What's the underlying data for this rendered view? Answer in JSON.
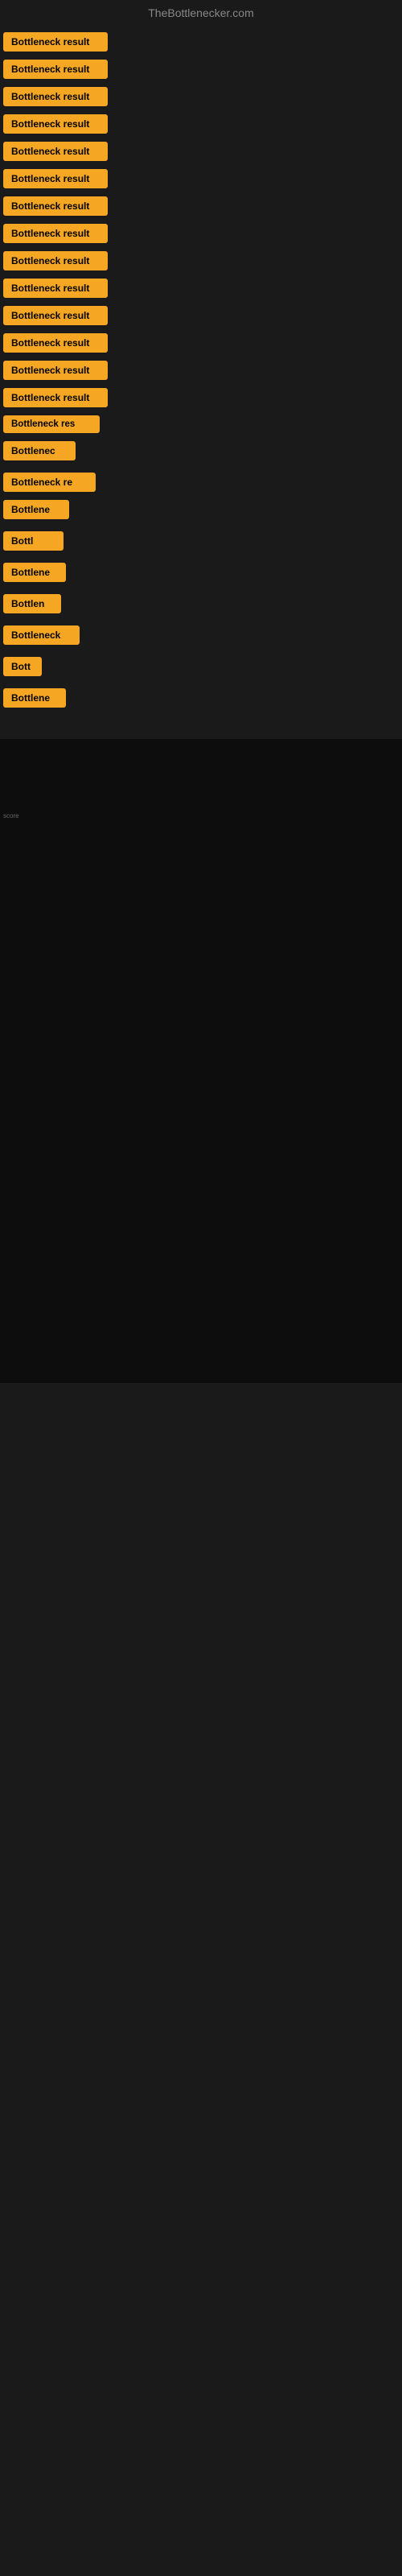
{
  "header": {
    "title": "TheBottlenecker.com"
  },
  "items": [
    {
      "label": "Bottleneck result",
      "rowClass": "row-1"
    },
    {
      "label": "Bottleneck result",
      "rowClass": "row-2"
    },
    {
      "label": "Bottleneck result",
      "rowClass": "row-3"
    },
    {
      "label": "Bottleneck result",
      "rowClass": "row-4"
    },
    {
      "label": "Bottleneck result",
      "rowClass": "row-5"
    },
    {
      "label": "Bottleneck result",
      "rowClass": "row-6"
    },
    {
      "label": "Bottleneck result",
      "rowClass": "row-7"
    },
    {
      "label": "Bottleneck result",
      "rowClass": "row-8"
    },
    {
      "label": "Bottleneck result",
      "rowClass": "row-9"
    },
    {
      "label": "Bottleneck result",
      "rowClass": "row-10"
    },
    {
      "label": "Bottleneck result",
      "rowClass": "row-11"
    },
    {
      "label": "Bottleneck result",
      "rowClass": "row-12"
    },
    {
      "label": "Bottleneck result",
      "rowClass": "row-13"
    },
    {
      "label": "Bottleneck result",
      "rowClass": "row-14"
    },
    {
      "label": "Bottleneck res",
      "rowClass": "row-15"
    },
    {
      "label": "Bottlenec",
      "rowClass": "row-16"
    },
    {
      "label": "Bottleneck re",
      "rowClass": "row-17"
    },
    {
      "label": "Bottlene",
      "rowClass": "row-18"
    },
    {
      "label": "Bottl",
      "rowClass": "row-19"
    },
    {
      "label": "Bottlene",
      "rowClass": "row-20"
    },
    {
      "label": "Bottlen",
      "rowClass": "row-21"
    },
    {
      "label": "Bottleneck",
      "rowClass": "row-22"
    },
    {
      "label": "Bott",
      "rowClass": "row-23"
    },
    {
      "label": "Bottlene",
      "rowClass": "row-24"
    }
  ],
  "small_label": "score",
  "accent_color": "#f5a623"
}
